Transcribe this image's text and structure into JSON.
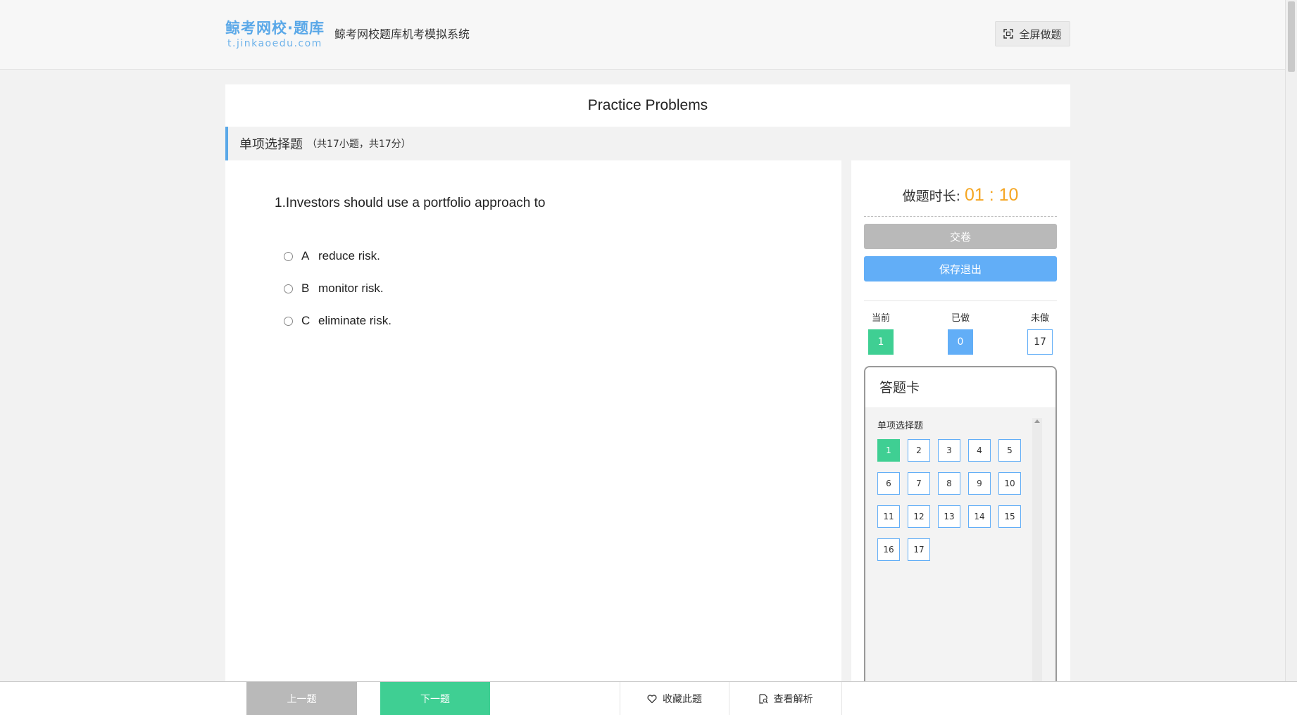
{
  "header": {
    "logo_cn": "鲸考网校·题库",
    "logo_url": "t.jinkaoedu.com",
    "system_title": "鲸考网校题库机考模拟系统",
    "fullscreen_label": "全屏做题"
  },
  "paper": {
    "title": "Practice Problems"
  },
  "section": {
    "name": "单项选择题",
    "meta": "（共17小题，共17分）"
  },
  "question": {
    "stem": "1.Investors should use a portfolio approach to",
    "options": [
      {
        "letter": "A",
        "text": "reduce risk."
      },
      {
        "letter": "B",
        "text": "monitor risk."
      },
      {
        "letter": "C",
        "text": "eliminate risk."
      }
    ]
  },
  "side": {
    "timer_label": "做题时长:",
    "timer_value": "01 : 10",
    "submit_label": "交卷",
    "save_exit_label": "保存退出",
    "status": {
      "current_label": "当前",
      "current_value": "1",
      "done_label": "已做",
      "done_value": "0",
      "undone_label": "未做",
      "undone_value": "17"
    }
  },
  "answer_card": {
    "title": "答题卡",
    "section_label": "单项选择题",
    "questions": [
      "1",
      "2",
      "3",
      "4",
      "5",
      "6",
      "7",
      "8",
      "9",
      "10",
      "11",
      "12",
      "13",
      "14",
      "15",
      "16",
      "17"
    ],
    "current": "1"
  },
  "bottom": {
    "prev_label": "上一题",
    "next_label": "下一题",
    "favorite_label": "收藏此题",
    "analysis_label": "查看解析"
  },
  "colors": {
    "accent_blue": "#62aef7",
    "accent_green": "#3fcf93",
    "timer_orange": "#f5a623",
    "disabled_gray": "#b9b9b9"
  },
  "icons": {
    "fullscreen": "fullscreen-icon",
    "favorite": "heart-icon",
    "analysis": "document-search-icon"
  }
}
